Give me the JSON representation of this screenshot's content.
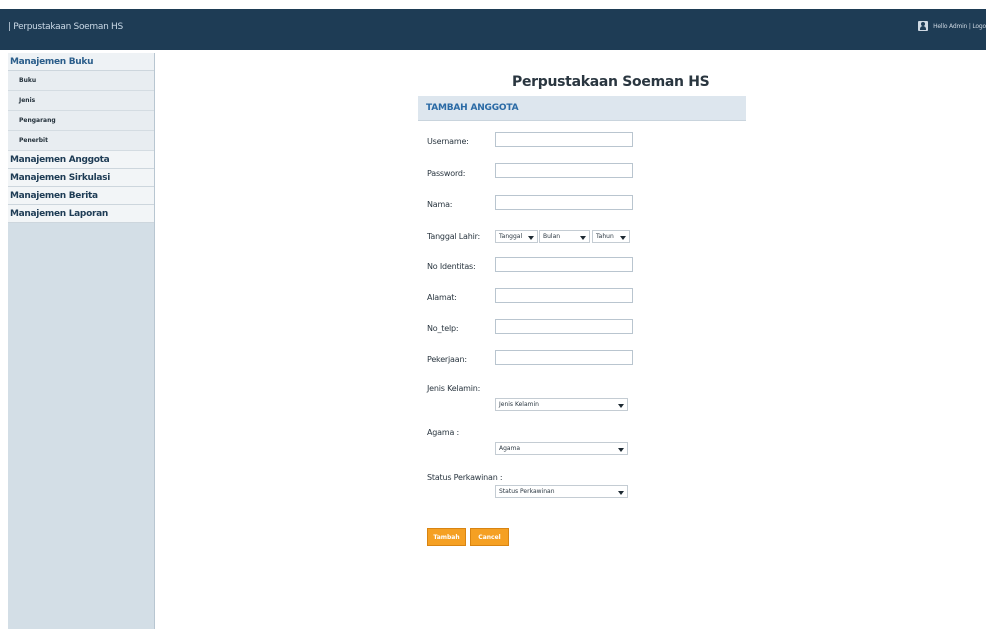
{
  "header": {
    "brand": "| Perpustakaan Soeman HS",
    "user_text": "Hello Admin | Logo"
  },
  "sidebar": {
    "groups": [
      {
        "label": "Manajemen Buku"
      },
      {
        "label": "Manajemen Anggota"
      },
      {
        "label": "Manajemen Sirkulasi"
      },
      {
        "label": "Manajemen Berita"
      },
      {
        "label": "Manajemen Laporan"
      }
    ],
    "sub_items": [
      "Buku",
      "Jenis",
      "Pengarang",
      "Penerbit"
    ]
  },
  "main": {
    "title": "Perpustakaan Soeman HS",
    "section": "TAMBAH ANGGOTA",
    "fields": {
      "username": "Username:",
      "password": "Password:",
      "nama": "Nama:",
      "tanggal_lahir": "Tanggal Lahir:",
      "no_identitas": "No Identitas:",
      "alamat": "Alamat:",
      "no_telp": "No_telp:",
      "pekerjaan": "Pekerjaan:",
      "jenis_kelamin": "Jenis Kelamin:",
      "agama": "Agama :",
      "status_perkawinan": "Status Perkawinan :"
    },
    "selects": {
      "tanggal": "Tanggal",
      "bulan": "Bulan",
      "tahun": "Tahun",
      "jenis_kelamin": "Jenis Kelamin",
      "agama": "Agama",
      "status_perkawinan": "Status Perkawinan"
    },
    "buttons": {
      "tambah": "Tambah",
      "cancel": "Cancel"
    }
  },
  "colors": {
    "header_bg": "#1e3c55",
    "sidebar_bg": "#d3dee6",
    "section_head_bg": "#dde6ee",
    "section_head_text": "#2a6aa5",
    "button_bg": "#f5a023"
  }
}
